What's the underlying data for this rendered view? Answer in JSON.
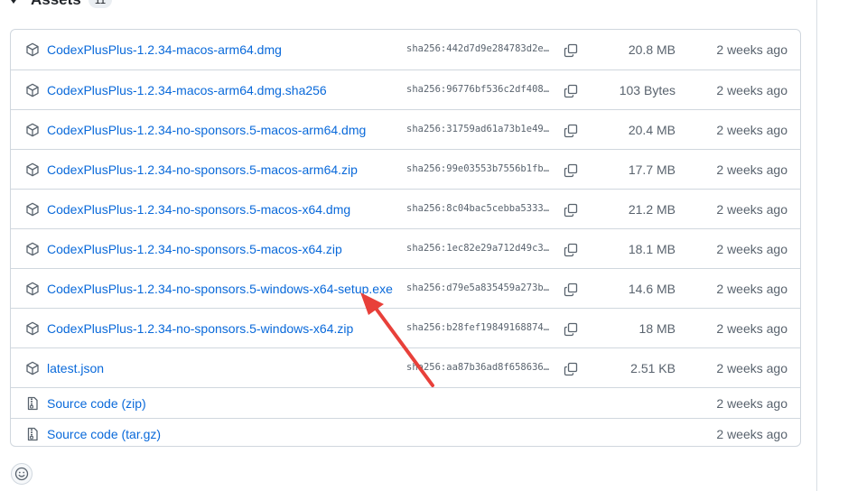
{
  "header": {
    "title": "Assets",
    "count": "11"
  },
  "assets": [
    {
      "name": "CodexPlusPlus-1.2.34-macos-arm64.dmg",
      "hash": "sha256:442d7d9e284783d2e…",
      "size": "20.8 MB",
      "date": "2 weeks ago"
    },
    {
      "name": "CodexPlusPlus-1.2.34-macos-arm64.dmg.sha256",
      "hash": "sha256:96776bf536c2df408…",
      "size": "103 Bytes",
      "date": "2 weeks ago"
    },
    {
      "name": "CodexPlusPlus-1.2.34-no-sponsors.5-macos-arm64.dmg",
      "hash": "sha256:31759ad61a73b1e49…",
      "size": "20.4 MB",
      "date": "2 weeks ago"
    },
    {
      "name": "CodexPlusPlus-1.2.34-no-sponsors.5-macos-arm64.zip",
      "hash": "sha256:99e03553b7556b1fb…",
      "size": "17.7 MB",
      "date": "2 weeks ago"
    },
    {
      "name": "CodexPlusPlus-1.2.34-no-sponsors.5-macos-x64.dmg",
      "hash": "sha256:8c04bac5cebba5333…",
      "size": "21.2 MB",
      "date": "2 weeks ago"
    },
    {
      "name": "CodexPlusPlus-1.2.34-no-sponsors.5-macos-x64.zip",
      "hash": "sha256:1ec82e29a712d49c3…",
      "size": "18.1 MB",
      "date": "2 weeks ago"
    },
    {
      "name": "CodexPlusPlus-1.2.34-no-sponsors.5-windows-x64-setup.exe",
      "hash": "sha256:d79e5a835459a273b…",
      "size": "14.6 MB",
      "date": "2 weeks ago"
    },
    {
      "name": "CodexPlusPlus-1.2.34-no-sponsors.5-windows-x64.zip",
      "hash": "sha256:b28fef19849168874…",
      "size": "18 MB",
      "date": "2 weeks ago"
    },
    {
      "name": "latest.json",
      "hash": "sha256:aa87b36ad8f658636…",
      "size": "2.51 KB",
      "date": "2 weeks ago"
    }
  ],
  "source": [
    {
      "name": "Source code",
      "ext": "(zip)",
      "date": "2 weeks ago"
    },
    {
      "name": "Source code",
      "ext": "(tar.gz)",
      "date": "2 weeks ago"
    }
  ],
  "icons": {
    "asset": "package-icon",
    "source": "file-zip-icon",
    "copy": "copy-icon",
    "reaction": "smiley-icon",
    "collapse": "triangle-down-icon"
  },
  "colors": {
    "link": "#0969da",
    "border": "#d0d7de",
    "muted": "#59636e",
    "annotation_arrow": "#e8403a"
  }
}
